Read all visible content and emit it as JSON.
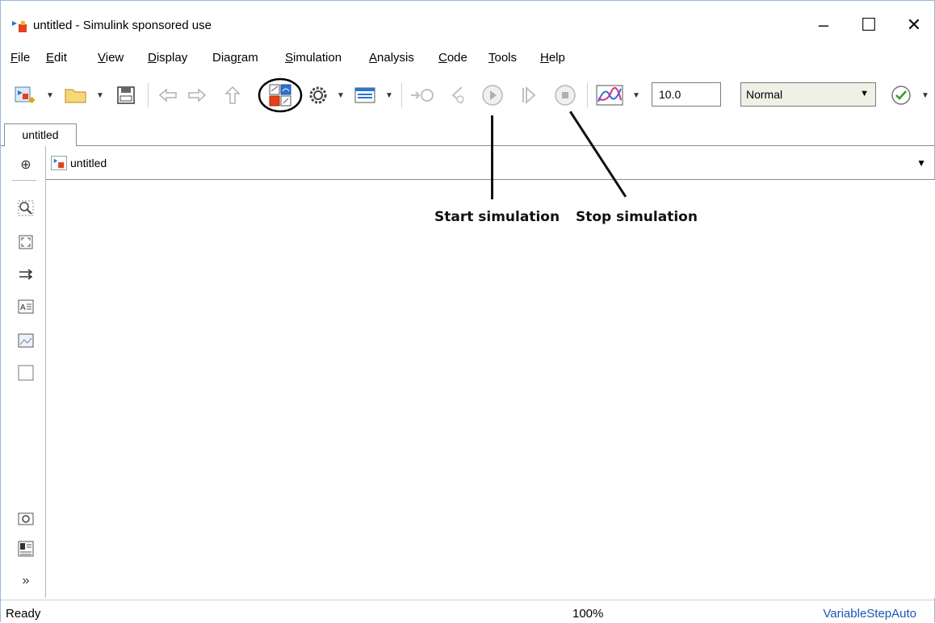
{
  "window": {
    "title": "untitled - Simulink sponsored use",
    "controls": {
      "minimize": "–",
      "maximize": "☐",
      "close": "✕"
    }
  },
  "menubar": {
    "items": [
      {
        "label_ul": "F",
        "label_rest": "ile"
      },
      {
        "label_ul": "E",
        "label_rest": "dit"
      },
      {
        "label_ul": "V",
        "label_rest": "iew"
      },
      {
        "label_ul": "D",
        "label_rest": "isplay"
      },
      {
        "label_pre": "Diag",
        "label_ul": "r",
        "label_rest": "am"
      },
      {
        "label_ul": "S",
        "label_rest": "imulation"
      },
      {
        "label_ul": "A",
        "label_rest": "nalysis"
      },
      {
        "label_ul": "C",
        "label_rest": "ode"
      },
      {
        "label_ul": "T",
        "label_rest": "ools"
      },
      {
        "label_ul": "H",
        "label_rest": "elp"
      }
    ]
  },
  "toolbar": {
    "stop_time": "10.0",
    "sim_mode": "Normal",
    "caret": "▼"
  },
  "tabs": [
    {
      "label": "untitled"
    }
  ],
  "address": {
    "path": "untitled",
    "caret": "▼"
  },
  "palette": {
    "expand_glyph": "»",
    "hide_glyph": "⊕"
  },
  "annotations": {
    "start": "Start simulation",
    "stop": "Stop simulation"
  },
  "status": {
    "left": "Ready",
    "zoom": "100%",
    "solver": "VariableStepAuto"
  },
  "colors": {
    "accent": "#1c55b4",
    "highlight_circle": "#000000",
    "red_block": "#e8401c",
    "blue_block": "#2b73d4"
  }
}
